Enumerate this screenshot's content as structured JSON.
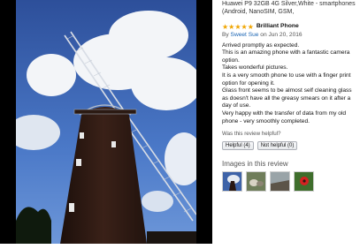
{
  "product": {
    "title": "Huawei P9 32GB 4G Silver,White - smartphones (Android, NanoSIM, GSM,"
  },
  "review": {
    "rating": 5,
    "rating_max": 5,
    "headline": "Brilliant Phone",
    "by_prefix": "By",
    "author": "Sweet Sue",
    "date": "on Jun 20, 2016",
    "lines": [
      "Arrived promptly as expected.",
      "This is an amazing phone with a fantastic camera option.",
      "Takes wonderful pictures.",
      "It is a very smooth phone to use with a finger print option for opening it.",
      "Glass front seems to be almost self cleaning glass as doesn't have all the greasy smears on it after a day of use.",
      "Very happy with the transfer of data from my old phone - very smoothly completed."
    ],
    "helpful_question": "Was this review helpful?",
    "helpful_label": "Helpful (4)",
    "not_helpful_label": "Not helpful (0)"
  },
  "images_section": {
    "heading": "Images in this review"
  },
  "colors": {
    "star": "#f0a500",
    "link": "#1a65b4",
    "photo_bg": "#000000"
  }
}
